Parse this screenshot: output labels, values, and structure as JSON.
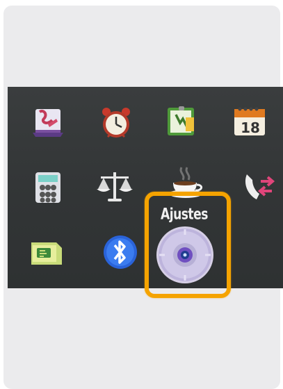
{
  "menu": {
    "selected_label": "Ajustes",
    "highlight_color": "#f5a300",
    "items": [
      {
        "icon": "notes-icon"
      },
      {
        "icon": "alarm-clock-icon"
      },
      {
        "icon": "tasks-icon"
      },
      {
        "icon": "calendar-icon",
        "text": "18"
      },
      {
        "icon": "calculator-icon"
      },
      {
        "icon": "scale-converter-icon"
      },
      {
        "icon": "coffee-cup-icon"
      },
      {
        "icon": "call-transfer-icon"
      },
      {
        "icon": "sim-card-icon"
      },
      {
        "icon": "bluetooth-icon"
      },
      {
        "icon": "settings-disc-icon",
        "selected": true
      }
    ]
  }
}
